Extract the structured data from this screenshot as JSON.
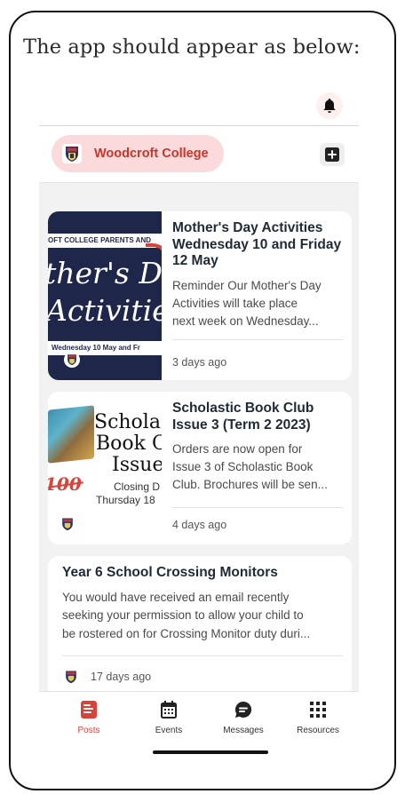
{
  "caption": "The app should appear as below:",
  "header": {
    "school_name": "Woodcroft College",
    "colors": {
      "accent": "#d8423a",
      "pill_bg": "#fadadb",
      "school_name": "#c7362c"
    }
  },
  "posts": [
    {
      "title": "Mother's Day Activities Wednesday 10 and Friday 12 May",
      "excerpt_lines": [
        "Reminder   Our Mother's Day",
        "Activities will take place",
        "next week on Wednesday..."
      ],
      "time": "3 days ago",
      "image": {
        "top_banner": "OFT COLLEGE PARENTS AND",
        "line1": "ther's D",
        "line2": "Activities",
        "bottom_banner": "Wednesday 10 May and Fr"
      }
    },
    {
      "title": "Scholastic Book Club Issue 3 (Term 2 2023)",
      "excerpt_lines": [
        "Orders are now open for",
        "Issue 3 of Scholastic Book",
        "Club. Brochures will be sen..."
      ],
      "time": "4 days ago",
      "image": {
        "line1": "Schola",
        "line2": "Book C",
        "line3": "Issue",
        "closing": "Closing D",
        "date": "Thursday 18",
        "number": "100"
      }
    },
    {
      "title": "Year 6 School Crossing Monitors",
      "excerpt_lines": [
        "You would have received an email recently",
        "seeking your permission to allow your child to",
        "be rostered on for Crossing Monitor duty duri..."
      ],
      "time": "17 days ago"
    }
  ],
  "tabs": [
    {
      "label": "Posts",
      "icon": "posts-icon",
      "active": true
    },
    {
      "label": "Events",
      "icon": "calendar-icon",
      "active": false
    },
    {
      "label": "Messages",
      "icon": "chat-icon",
      "active": false
    },
    {
      "label": "Resources",
      "icon": "grid-icon",
      "active": false
    }
  ]
}
